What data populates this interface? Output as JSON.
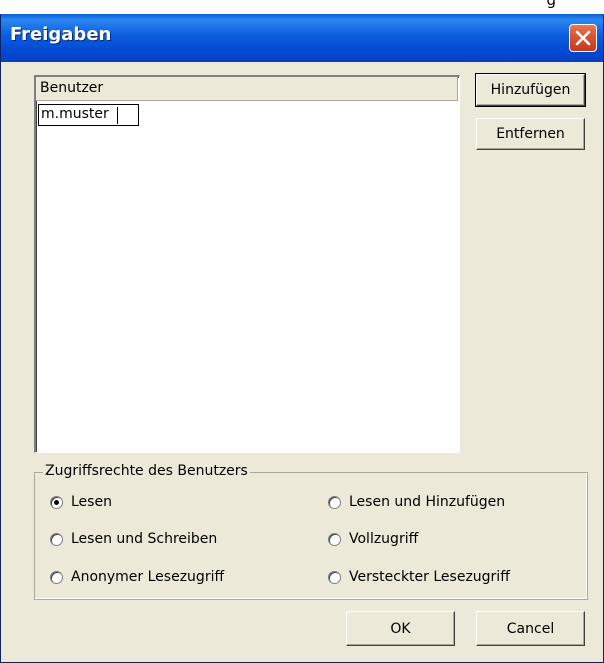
{
  "backdrop": {
    "partial_text": "g"
  },
  "window": {
    "title": "Freigaben",
    "close_icon": "close-icon"
  },
  "user_list": {
    "column_header": "Benutzer",
    "edit_value": "m.muster"
  },
  "side_buttons": {
    "add_label": "Hinzufügen",
    "remove_label": "Entfernen"
  },
  "permissions": {
    "group_title": "Zugriffsrechte des Benutzers",
    "selected": "read",
    "options": [
      {
        "id": "read",
        "label": "Lesen"
      },
      {
        "id": "read-add",
        "label": "Lesen und Hinzufügen"
      },
      {
        "id": "read-write",
        "label": "Lesen und Schreiben"
      },
      {
        "id": "full",
        "label": "Vollzugriff"
      },
      {
        "id": "anon-read",
        "label": "Anonymer Lesezugriff"
      },
      {
        "id": "hidden-read",
        "label": "Versteckter Lesezugriff"
      }
    ]
  },
  "footer": {
    "ok_label": "OK",
    "cancel_label": "Cancel"
  },
  "colors": {
    "titlebar": "#0054e3",
    "dialog_face": "#ece9d8",
    "close_button": "#d8532f"
  }
}
